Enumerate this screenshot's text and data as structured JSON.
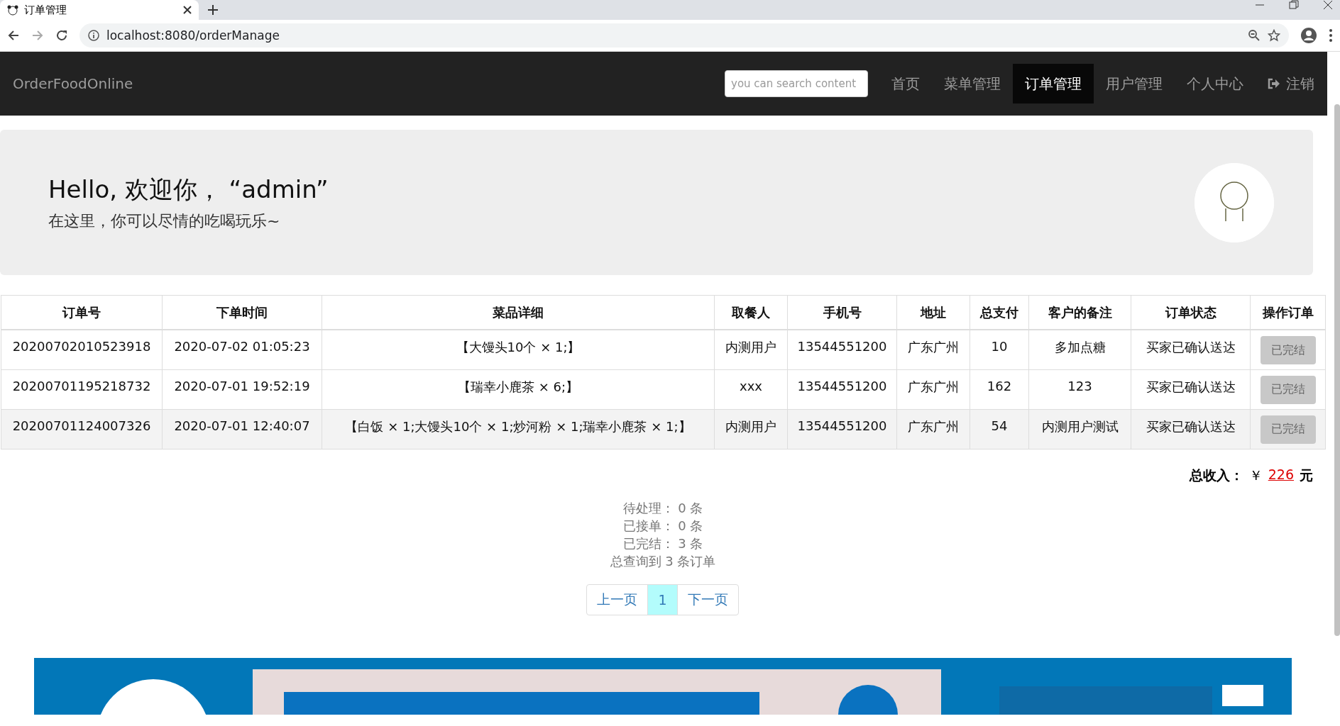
{
  "browser": {
    "tab_title": "订单管理",
    "url": "localhost:8080/orderManage"
  },
  "navbar": {
    "brand": "OrderFoodOnline",
    "search": {
      "placeholder": "you can search content"
    },
    "links": [
      {
        "label": "首页",
        "selected": false
      },
      {
        "label": "菜单管理",
        "selected": false
      },
      {
        "label": "订单管理",
        "selected": true
      },
      {
        "label": "用户管理",
        "selected": false
      },
      {
        "label": "个人中心",
        "selected": false
      }
    ],
    "logout": "注销"
  },
  "jumbotron": {
    "heading": "Hello, 欢迎你， “admin”",
    "subtitle": "在这里，你可以尽情的吃喝玩乐~"
  },
  "table": {
    "columns": [
      "订单号",
      "下单时间",
      "菜品详细",
      "取餐人",
      "手机号",
      "地址",
      "总支付",
      "客户的备注",
      "订单状态",
      "操作订单"
    ],
    "rows": [
      {
        "highlighted": false,
        "cells": [
          "20200702010523918",
          "2020-07-02 01:05:23",
          "【大馒头10个 × 1;】",
          "内测用户",
          "13544551200",
          "广东广州",
          "10",
          "多加点糖",
          "买家已确认送达"
        ],
        "action": "已完结"
      },
      {
        "highlighted": false,
        "cells": [
          "20200701195218732",
          "2020-07-01 19:52:19",
          "【瑞幸小鹿茶 × 6;】",
          "xxx",
          "13544551200",
          "广东广州",
          "162",
          "123",
          "买家已确认送达"
        ],
        "action": "已完结"
      },
      {
        "highlighted": true,
        "cells": [
          "20200701124007326",
          "2020-07-01 12:40:07",
          "【白饭 × 1;大馒头10个 × 1;炒河粉 × 1;瑞幸小鹿茶 × 1;】",
          "内测用户",
          "13544551200",
          "广东广州",
          "54",
          "内测用户测试",
          "买家已确认送达"
        ],
        "action": "已完结"
      }
    ]
  },
  "summary": {
    "label": "总收入：",
    "currency": "￥",
    "amount": "226",
    "unit": "元"
  },
  "stats": [
    "待处理： 0 条",
    "已接单： 0 条",
    "已完结： 3 条",
    "总查询到 3 条订单"
  ],
  "pagination": {
    "prev": "上一页",
    "pages": [
      {
        "label": "1",
        "selected": true
      }
    ],
    "next": "下一页"
  },
  "banner": {
    "kind": "picture"
  }
}
